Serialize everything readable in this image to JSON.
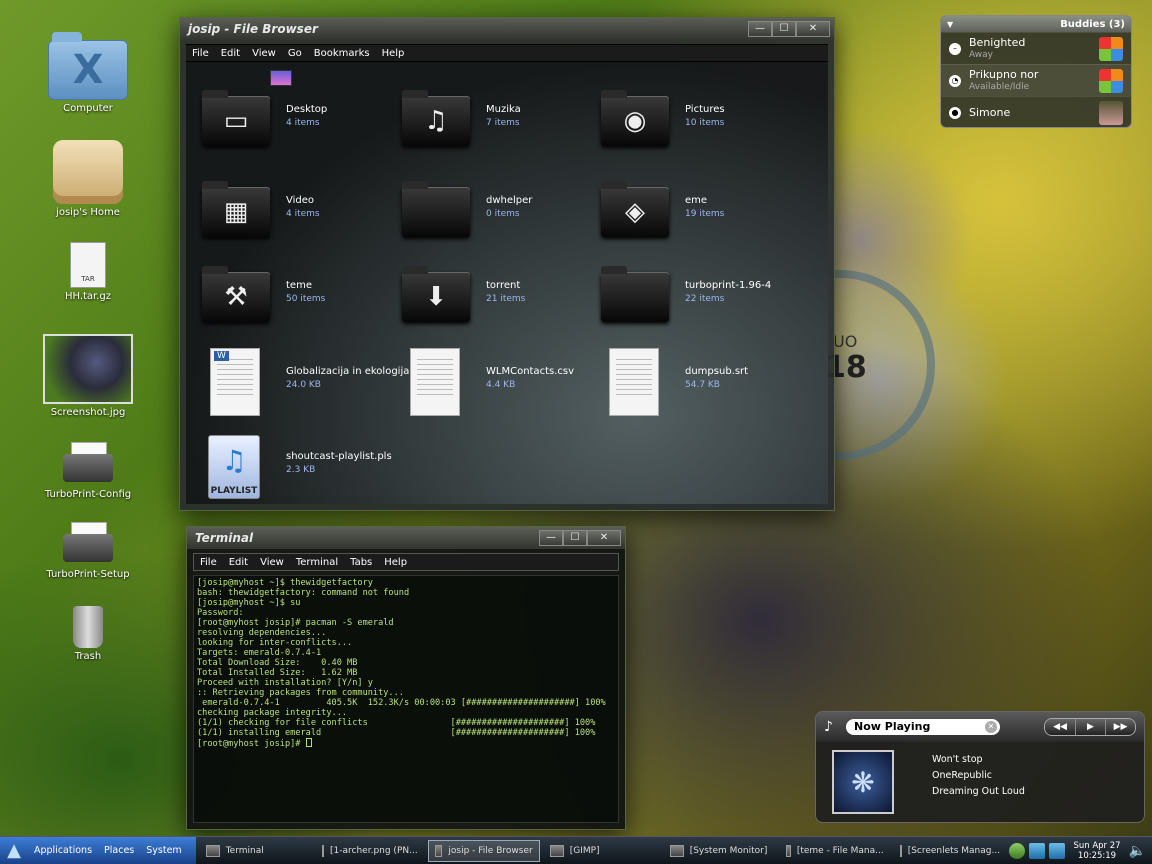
{
  "desktop": {
    "icons": [
      {
        "label": "Computer"
      },
      {
        "label": "josip's Home"
      },
      {
        "label": "HH.tar.gz",
        "badge": "TAR"
      },
      {
        "label": "Screenshot.jpg"
      },
      {
        "label": "TurboPrint-Config"
      },
      {
        "label": "TurboPrint-Setup"
      },
      {
        "label": "Trash"
      }
    ]
  },
  "file_browser": {
    "title": "josip - File Browser",
    "menu": [
      "File",
      "Edit",
      "View",
      "Go",
      "Bookmarks",
      "Help"
    ],
    "items": [
      {
        "name": "Desktop",
        "sub": "4 items",
        "kind": "folder",
        "icon": "desktop-icon"
      },
      {
        "name": "Muzika",
        "sub": "7 items",
        "kind": "folder",
        "icon": "music-note-icon"
      },
      {
        "name": "Pictures",
        "sub": "10 items",
        "kind": "folder",
        "icon": "camera-icon"
      },
      {
        "name": "Video",
        "sub": "4 items",
        "kind": "folder",
        "icon": "film-icon"
      },
      {
        "name": "dwhelper",
        "sub": "0 items",
        "kind": "folder",
        "icon": "folder-icon"
      },
      {
        "name": "eme",
        "sub": "19 items",
        "kind": "folder",
        "icon": "pedestrian-sign-icon"
      },
      {
        "name": "teme",
        "sub": "50 items",
        "kind": "folder",
        "icon": "hammer-icon"
      },
      {
        "name": "torrent",
        "sub": "21 items",
        "kind": "folder",
        "icon": "download-icon"
      },
      {
        "name": "turboprint-1.96-4",
        "sub": "22 items",
        "kind": "folder",
        "icon": "folder-icon"
      },
      {
        "name": "Globalizacija in ekologija.doc",
        "sub": "24.0 KB",
        "kind": "doc-word",
        "icon": "word-document-icon"
      },
      {
        "name": "WLMContacts.csv",
        "sub": "4.4 KB",
        "kind": "doc",
        "icon": "text-document-icon"
      },
      {
        "name": "dumpsub.srt",
        "sub": "54.7 KB",
        "kind": "doc",
        "icon": "text-document-icon"
      },
      {
        "name": "shoutcast-playlist.pls",
        "sub": "2.3 KB",
        "kind": "playlist",
        "icon": "playlist-icon",
        "badge": "PLAYLIST"
      }
    ]
  },
  "terminal": {
    "title": "Terminal",
    "menu": [
      "File",
      "Edit",
      "View",
      "Terminal",
      "Tabs",
      "Help"
    ],
    "lines": [
      "[josip@myhost ~]$ thewidgetfactory",
      "bash: thewidgetfactory: command not found",
      "[josip@myhost ~]$ su",
      "Password:",
      "[root@myhost josip]# pacman -S emerald",
      "resolving dependencies...",
      "looking for inter-conflicts...",
      "",
      "Targets: emerald-0.7.4-1",
      "",
      "Total Download Size:    0.40 MB",
      "Total Installed Size:   1.62 MB",
      "",
      "Proceed with installation? [Y/n] y",
      ":: Retrieving packages from community...",
      " emerald-0.7.4-1         405.5K  152.3K/s 00:00:03 [#####################] 100%",
      "checking package integrity...",
      "(1/1) checking for file conflicts                [#####################] 100%",
      "(1/1) installing emerald                         [#####################] 100%",
      "[root@myhost josip]# "
    ]
  },
  "buddies": {
    "title": "Buddies (3)",
    "list": [
      {
        "name": "Benighted",
        "status": "Away"
      },
      {
        "name": "Prikupno nor",
        "status": "Available/Idle"
      },
      {
        "name": "Simone",
        "status": ""
      }
    ]
  },
  "clock_widget": {
    "day": "UO",
    "number": "18"
  },
  "now_playing": {
    "title": "Now Playing",
    "track": "Won't stop",
    "artist": "OneRepublic",
    "album": "Dreaming Out Loud",
    "controls": {
      "prev": "◀◀",
      "play": "▶",
      "next": "▶▶"
    }
  },
  "taskbar": {
    "menus": [
      "Applications",
      "Places",
      "System"
    ],
    "tasks": [
      {
        "label": "Terminal",
        "active": false
      },
      {
        "label": "[1-archer.png (PN...",
        "active": false
      },
      {
        "label": "josip - File Browser",
        "active": true
      },
      {
        "label": "[GIMP]",
        "active": false
      },
      {
        "label": "[System Monitor]",
        "active": false
      },
      {
        "label": "[teme - File Mana...",
        "active": false
      },
      {
        "label": "[Screenlets Manag...",
        "active": false
      }
    ],
    "date": "Sun Apr 27",
    "time": "10:25:19"
  }
}
